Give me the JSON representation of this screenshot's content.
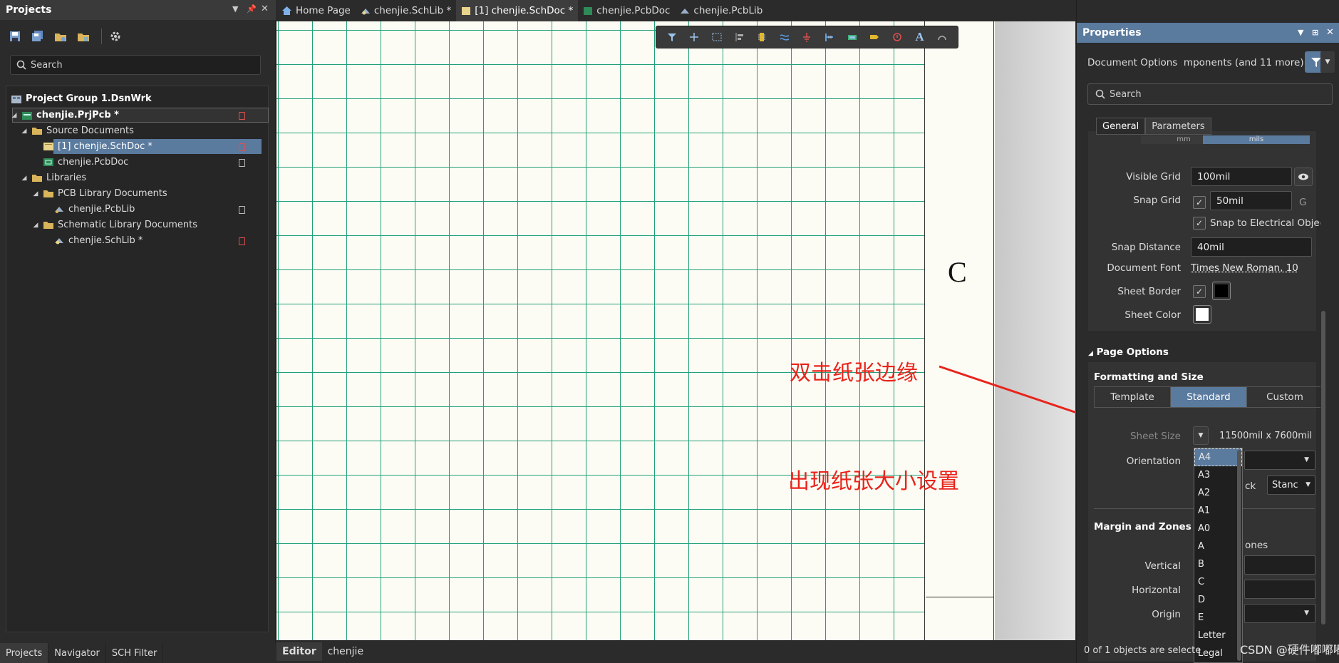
{
  "projects_panel": {
    "title": "Projects",
    "search_placeholder": "Search",
    "tree": {
      "group": "Project Group 1.DsnWrk",
      "project": "chenjie.PrjPcb *",
      "source_folder": "Source Documents",
      "schdoc": "[1] chenjie.SchDoc *",
      "pcbdoc": "chenjie.PcbDoc",
      "libraries": "Libraries",
      "pcb_lib_folder": "PCB Library Documents",
      "pcblib": "chenjie.PcbLib",
      "sch_lib_folder": "Schematic Library Documents",
      "schlib": "chenjie.SchLib *"
    },
    "bottom_tabs": [
      "Projects",
      "Navigator",
      "SCH Filter"
    ]
  },
  "doc_tabs": [
    "Home Page",
    "chenjie.SchLib *",
    "[1] chenjie.SchDoc *",
    "chenjie.PcbDoc",
    "chenjie.PcbLib"
  ],
  "canvas": {
    "zone_label": "C",
    "note_1": "双击纸张边缘",
    "note_2": "出现纸张大小设置"
  },
  "editor_tabs": [
    "Editor",
    "chenjie"
  ],
  "properties": {
    "title": "Properties",
    "doc_options": "Document Options",
    "filter_text": "mponents (and 11 more)",
    "search_placeholder": "Search",
    "tabs": [
      "General",
      "Parameters"
    ],
    "hidden_tabs": [
      "mm",
      "mils"
    ],
    "visible_grid_label": "Visible Grid",
    "visible_grid": "100mil",
    "snap_grid_label": "Snap Grid",
    "snap_grid": "50mil",
    "snap_grid_key": "G",
    "snap_electrical": "Snap to Electrical Object",
    "snap_distance_label": "Snap Distance",
    "snap_distance": "40mil",
    "doc_font_label": "Document Font",
    "doc_font": "Times New Roman, 10",
    "sheet_border_label": "Sheet Border",
    "sheet_color_label": "Sheet Color",
    "page_options": "Page Options",
    "formatting": "Formatting and Size",
    "format_buttons": [
      "Template",
      "Standard",
      "Custom"
    ],
    "sheet_size_label": "Sheet Size",
    "sheet_size": "11500mil  x  7600mil",
    "orientation_label": "Orientation",
    "title_block_frag": "ck",
    "title_block_value": "Stanc",
    "margin_zones": "Margin and Zones",
    "zones_frag": "ones",
    "vertical_label": "Vertical",
    "horizontal_label": "Horizontal",
    "origin_label": "Origin",
    "sheet_sizes": [
      "A4",
      "A3",
      "A2",
      "A1",
      "A0",
      "A",
      "B",
      "C",
      "D",
      "E",
      "Letter",
      "Legal"
    ],
    "status": "0 of 1 objects are selecte"
  },
  "watermark": "CSDN @硬件嘟嘟嘟",
  "colors": {
    "accent": "#5a7a9e",
    "grid": "#22a07a",
    "annotation": "#e8241b",
    "border_swatch": "#000000",
    "sheet_swatch": "#ffffff"
  }
}
